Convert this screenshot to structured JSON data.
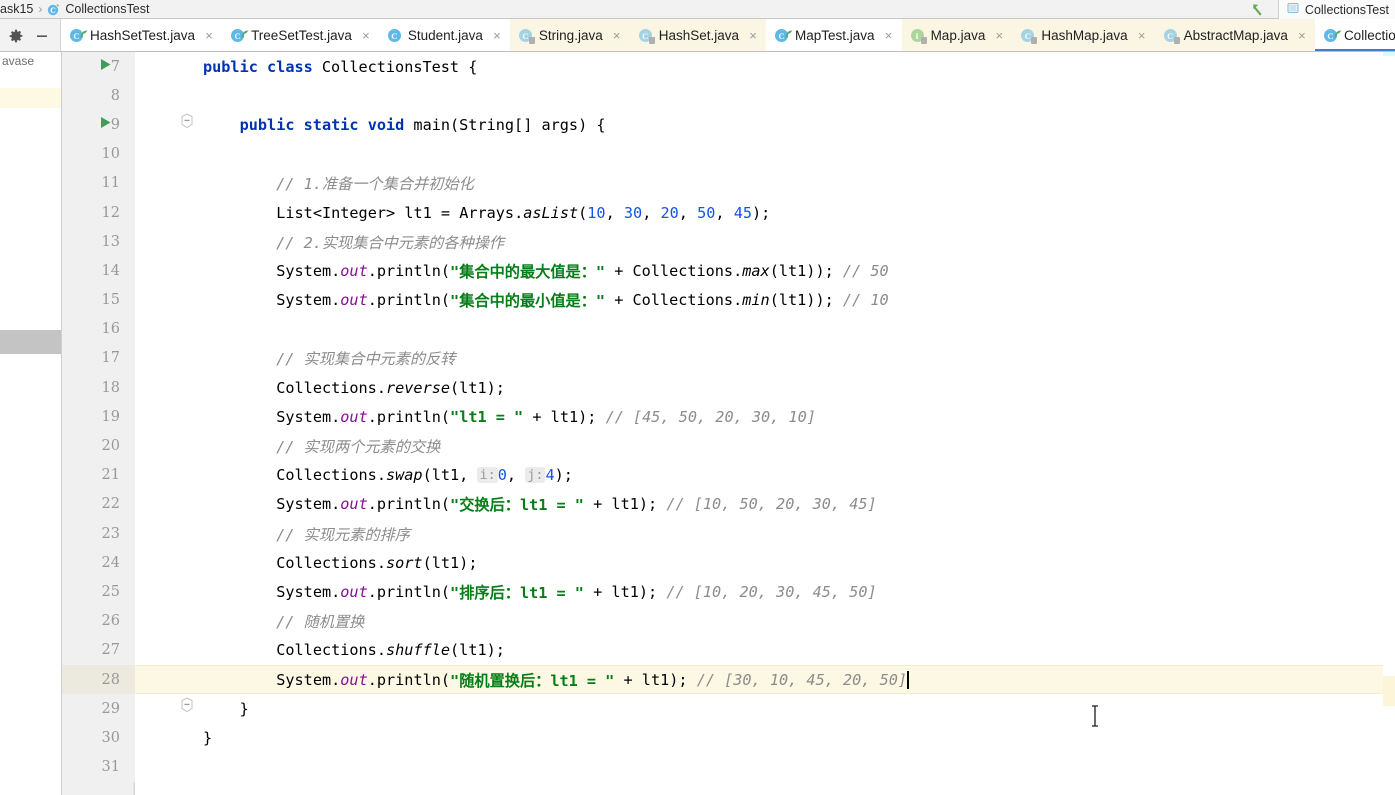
{
  "window": {
    "app": "IntelliJ IDEA",
    "theme_bg": "#ffffff",
    "accent": "#3d7bd4"
  },
  "navbar": {
    "breadcrumb": [
      {
        "label": "ask15",
        "icon": "folder-icon"
      },
      {
        "label": "CollectionsTest",
        "icon": "java-class-icon"
      }
    ],
    "separator": "›",
    "run_config": {
      "label": "CollectionsTest",
      "icon": "run-config-icon"
    },
    "back_arrow_icon": "green-back-arrow-icon"
  },
  "toolbar": {
    "settings_icon": "gear-icon",
    "collapse_icon": "minus-icon"
  },
  "tabs": [
    {
      "label": "HashSetTest.java",
      "icon": "class-run-icon",
      "kind": "class",
      "runnable": true,
      "readonly": false,
      "style": "white",
      "active": false,
      "close": "×"
    },
    {
      "label": "TreeSetTest.java",
      "icon": "class-run-icon",
      "kind": "class",
      "runnable": true,
      "readonly": false,
      "style": "white",
      "active": false,
      "close": "×"
    },
    {
      "label": "Student.java",
      "icon": "class-icon",
      "kind": "class",
      "runnable": false,
      "readonly": false,
      "style": "white",
      "active": false,
      "close": "×"
    },
    {
      "label": "String.java",
      "icon": "class-readonly-icon",
      "kind": "class",
      "runnable": false,
      "readonly": true,
      "style": "lib",
      "active": false,
      "close": "×"
    },
    {
      "label": "HashSet.java",
      "icon": "class-readonly-icon",
      "kind": "class",
      "runnable": false,
      "readonly": true,
      "style": "lib",
      "active": false,
      "close": "×"
    },
    {
      "label": "MapTest.java",
      "icon": "class-run-icon",
      "kind": "class",
      "runnable": true,
      "readonly": false,
      "style": "white",
      "active": false,
      "close": "×"
    },
    {
      "label": "Map.java",
      "icon": "interface-readonly-icon",
      "kind": "interface",
      "runnable": false,
      "readonly": true,
      "style": "lib",
      "active": false,
      "close": "×"
    },
    {
      "label": "HashMap.java",
      "icon": "class-readonly-icon",
      "kind": "class",
      "runnable": false,
      "readonly": true,
      "style": "lib",
      "active": false,
      "close": "×"
    },
    {
      "label": "AbstractMap.java",
      "icon": "class-readonly-icon",
      "kind": "class",
      "runnable": false,
      "readonly": true,
      "style": "lib",
      "active": false,
      "close": "×"
    },
    {
      "label": "CollectionsTest.java",
      "icon": "class-run-icon",
      "kind": "class",
      "runnable": true,
      "readonly": false,
      "style": "white",
      "active": true,
      "close": "×"
    }
  ],
  "left_panel": {
    "label": "avase"
  },
  "editor": {
    "file": "CollectionsTest.java",
    "language": "Java",
    "current_line": 28,
    "caret_line": 28,
    "first_visible_line": 7,
    "last_visible_line": 31,
    "lines": [
      {
        "n": 7,
        "run": true,
        "fold": false,
        "current": false,
        "indent": 0
      },
      {
        "n": 8,
        "run": false,
        "fold": false,
        "current": false,
        "indent": 0
      },
      {
        "n": 9,
        "run": true,
        "fold": true,
        "current": false,
        "indent": 1
      },
      {
        "n": 10,
        "run": false,
        "fold": false,
        "current": false,
        "indent": 1
      },
      {
        "n": 11,
        "run": false,
        "fold": false,
        "current": false,
        "indent": 2
      },
      {
        "n": 12,
        "run": false,
        "fold": false,
        "current": false,
        "indent": 2
      },
      {
        "n": 13,
        "run": false,
        "fold": false,
        "current": false,
        "indent": 2
      },
      {
        "n": 14,
        "run": false,
        "fold": false,
        "current": false,
        "indent": 2
      },
      {
        "n": 15,
        "run": false,
        "fold": false,
        "current": false,
        "indent": 2
      },
      {
        "n": 16,
        "run": false,
        "fold": false,
        "current": false,
        "indent": 2
      },
      {
        "n": 17,
        "run": false,
        "fold": false,
        "current": false,
        "indent": 2
      },
      {
        "n": 18,
        "run": false,
        "fold": false,
        "current": false,
        "indent": 2
      },
      {
        "n": 19,
        "run": false,
        "fold": false,
        "current": false,
        "indent": 2
      },
      {
        "n": 20,
        "run": false,
        "fold": false,
        "current": false,
        "indent": 2
      },
      {
        "n": 21,
        "run": false,
        "fold": false,
        "current": false,
        "indent": 2
      },
      {
        "n": 22,
        "run": false,
        "fold": false,
        "current": false,
        "indent": 2
      },
      {
        "n": 23,
        "run": false,
        "fold": false,
        "current": false,
        "indent": 2
      },
      {
        "n": 24,
        "run": false,
        "fold": false,
        "current": false,
        "indent": 2
      },
      {
        "n": 25,
        "run": false,
        "fold": false,
        "current": false,
        "indent": 2
      },
      {
        "n": 26,
        "run": false,
        "fold": false,
        "current": false,
        "indent": 2
      },
      {
        "n": 27,
        "run": false,
        "fold": false,
        "current": false,
        "indent": 2
      },
      {
        "n": 28,
        "run": false,
        "fold": false,
        "current": true,
        "indent": 2
      },
      {
        "n": 29,
        "run": false,
        "fold": true,
        "current": false,
        "indent": 1
      },
      {
        "n": 30,
        "run": false,
        "fold": false,
        "current": false,
        "indent": 0
      },
      {
        "n": 31,
        "run": false,
        "fold": false,
        "current": false,
        "indent": 0
      }
    ],
    "source_lines": {
      "7": "public class CollectionsTest {",
      "8": "",
      "9": "    public static void main(String[] args) {",
      "10": "",
      "11": "        // 1.准备一个集合并初始化",
      "12": "        List<Integer> lt1 = Arrays.asList(10, 30, 20, 50, 45);",
      "13": "        // 2.实现集合中元素的各种操作",
      "14": "        System.out.println(\"集合中的最大值是：\" + Collections.max(lt1)); // 50",
      "15": "        System.out.println(\"集合中的最小值是：\" + Collections.min(lt1)); // 10",
      "16": "",
      "17": "        // 实现集合中元素的反转",
      "18": "        Collections.reverse(lt1);",
      "19": "        System.out.println(\"lt1 = \" + lt1); // [45, 50, 20, 30, 10]",
      "20": "        // 实现两个元素的交换",
      "21": "        Collections.swap(lt1, i: 0, j: 4);",
      "22": "        System.out.println(\"交换后：lt1 = \" + lt1); // [10, 50, 20, 30, 45]",
      "23": "        // 实现元素的排序",
      "24": "        Collections.sort(lt1);",
      "25": "        System.out.println(\"排序后：lt1 = \" + lt1); // [10, 20, 30, 45, 50]",
      "26": "        // 随机置换",
      "27": "        Collections.shuffle(lt1);",
      "28": "        System.out.println(\"随机置换后：lt1 = \" + lt1); // [30, 10, 45, 20, 50]",
      "29": "    }",
      "30": "}",
      "31": ""
    },
    "inlay_hints": [
      {
        "line": 21,
        "name": "i",
        "value": "0"
      },
      {
        "line": 21,
        "name": "j",
        "value": "4"
      }
    ],
    "comment_values": {
      "line14": "// 50",
      "line15": "// 10",
      "line19": "// [45, 50, 20, 30, 10]",
      "line22": "// [10, 50, 20, 30, 45]",
      "line25": "// [10, 20, 30, 45, 50]",
      "line28": "// [30, 10, 45, 20, 50]"
    },
    "list_initial_values": [
      "10",
      "30",
      "20",
      "50",
      "45"
    ],
    "colors": {
      "keyword": "#0033b3",
      "string": "#067d17",
      "number": "#1750eb",
      "comment": "#8c8c8c",
      "static_field": "#871094",
      "current_line_bg": "#fdf8e4",
      "gutter_bg": "#f0f0f0",
      "line_number": "#999999"
    }
  }
}
